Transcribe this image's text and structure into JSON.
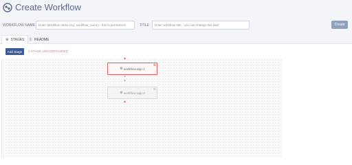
{
  "header": {
    "title": "Create Workflow",
    "title_icon": "workflow-icon",
    "workflow_name_label": "WORKFLOW NAME",
    "workflow_name_placeholder": "Enter Workflow name (eg: workflow_name) - this is permanent",
    "title_label": "TITLE",
    "title_placeholder": "Enter workflow title - you can change this later",
    "create_label": "Create"
  },
  "tabs": [
    {
      "label": "STAGES",
      "icon": "stages-icon",
      "active": true
    },
    {
      "label": "README",
      "icon": "info-icon",
      "active": false
    }
  ],
  "toolbar": {
    "add_stage_label": "Add Stage",
    "status_text": "1 STAGE UNCONFIGURED"
  },
  "stages": [
    {
      "label": "workflow-app-1",
      "configured": false
    },
    {
      "label": "workflow-app-2",
      "configured": true
    }
  ],
  "colors": {
    "accent": "#3d5a99",
    "error": "#e05c5c",
    "header_bg": "#f3f5f9"
  }
}
